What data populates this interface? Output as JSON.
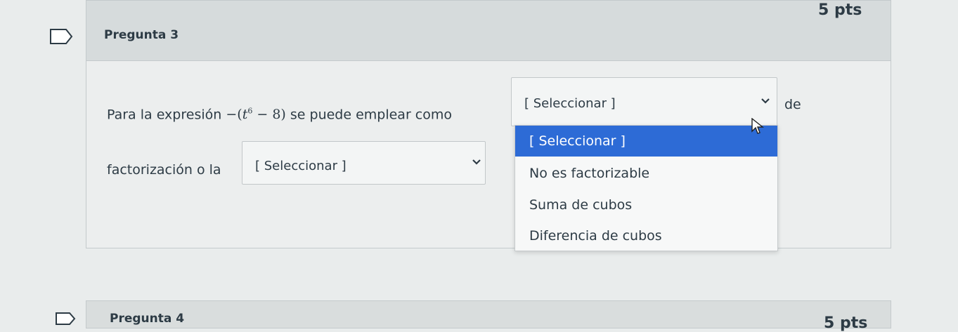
{
  "question3": {
    "title": "Pregunta 3",
    "points": "5 pts",
    "text_before_math": "Para la expresión",
    "math": {
      "prefix": "−(",
      "var": "t",
      "exp": "6",
      "suffix": " − 8)"
    },
    "text_after_math": "se puede emplear como",
    "text_de": "de",
    "text_factorization": "factorización  o la",
    "dropdown1": {
      "value": "[ Seleccionar ]",
      "expanded": true
    },
    "dropdown2": {
      "value": "[ Seleccionar ]",
      "expanded": false
    },
    "options": [
      {
        "label": "[ Seleccionar ]",
        "selected": true
      },
      {
        "label": "No es factorizable",
        "selected": false
      },
      {
        "label": "Suma de cubos",
        "selected": false
      },
      {
        "label": "Diferencia de cubos",
        "selected": false
      }
    ]
  },
  "question4": {
    "title": "Pregunta 4",
    "points": "5 pts"
  },
  "colors": {
    "selected_option": "#2d6bd6",
    "text": "#2d3b45",
    "header_bg": "#d6dbdc"
  }
}
